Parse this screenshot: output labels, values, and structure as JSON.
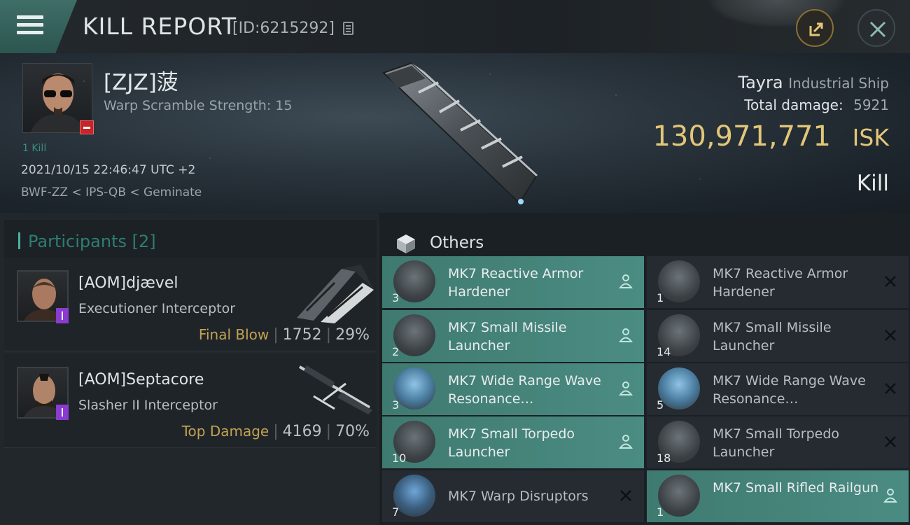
{
  "header": {
    "title": "KILL REPORT",
    "report_id": "[ID:6215292]"
  },
  "victim": {
    "name": "[ZJZ]菠",
    "warp_scramble": "Warp Scramble Strength: 15",
    "kills": "1 Kill",
    "datetime": "2021/10/15 22:46:47 UTC +2",
    "location": "BWF-ZZ < IPS-QB < Geminate",
    "ship_name": "Tayra",
    "ship_class": "Industrial Ship",
    "total_damage_label": "Total damage:",
    "total_damage": "5921",
    "isk_value": "130,971,771",
    "isk_unit": "ISK",
    "result": "Kill"
  },
  "participants": {
    "title": "Participants [2]",
    "rows": [
      {
        "name": "[AOM]djævel",
        "ship": "Executioner Interceptor",
        "role": "Final Blow",
        "damage": "1752",
        "percent": "29%"
      },
      {
        "name": "[AOM]Septacore",
        "ship": "Slasher II Interceptor",
        "role": "Top Damage",
        "damage": "4169",
        "percent": "70%"
      }
    ]
  },
  "others": {
    "title": "Others",
    "items": [
      {
        "name": "MK7 Reactive Armor Hardener",
        "qty": "3",
        "status": "dropped",
        "icon": "armor-hardener-icon"
      },
      {
        "name": "MK7 Reactive Armor Hardener",
        "qty": "1",
        "status": "destroyed",
        "icon": "armor-hardener-icon"
      },
      {
        "name": "MK7 Small Missile Launcher",
        "qty": "2",
        "status": "dropped",
        "icon": "missile-launcher-icon"
      },
      {
        "name": "MK7 Small Missile Launcher",
        "qty": "14",
        "status": "destroyed",
        "icon": "missile-launcher-icon"
      },
      {
        "name": "MK7 Wide Range Wave Resonance…",
        "qty": "3",
        "status": "dropped",
        "icon": "resonance-icon"
      },
      {
        "name": "MK7 Wide Range Wave Resonance…",
        "qty": "5",
        "status": "destroyed",
        "icon": "resonance-icon"
      },
      {
        "name": "MK7 Small Torpedo Launcher",
        "qty": "10",
        "status": "dropped",
        "icon": "torpedo-launcher-icon"
      },
      {
        "name": "MK7 Small Torpedo Launcher",
        "qty": "18",
        "status": "destroyed",
        "icon": "torpedo-launcher-icon"
      },
      {
        "name": "MK7 Warp Disruptors",
        "qty": "7",
        "status": "destroyed",
        "icon": "warp-disruptor-icon"
      },
      {
        "name": "MK7 Small Rifled Railgun",
        "qty": "1",
        "status": "dropped",
        "icon": "railgun-icon"
      }
    ]
  },
  "colors": {
    "accent_teal": "#4b8c82",
    "isk_gold": "#e3c679",
    "role_gold": "#c1a253",
    "badge_red": "#c4262a",
    "badge_purple": "#8a3bd0"
  }
}
